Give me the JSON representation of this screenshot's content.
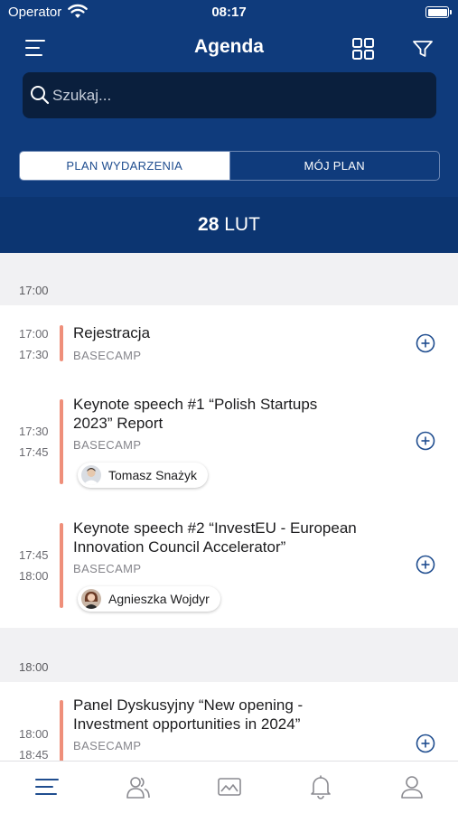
{
  "status_bar": {
    "carrier": "Operator",
    "time": "08:17"
  },
  "header": {
    "title": "Agenda",
    "search_placeholder": "Szukaj...",
    "tabs": [
      {
        "label": "PLAN WYDARZENIA",
        "active": true
      },
      {
        "label": "MÓJ PLAN",
        "active": false
      }
    ],
    "date": {
      "day": "28",
      "month": "LUT"
    }
  },
  "agenda": {
    "groups": [
      {
        "time": "17:00",
        "events": [
          {
            "start": "17:00",
            "end": "17:30",
            "title": "Rejestracja",
            "location": "BASECAMP"
          },
          {
            "start": "17:30",
            "end": "17:45",
            "title_line1": "Keynote speech #1 “Polish Startups",
            "title_line2": "2023” Report",
            "location": "BASECAMP",
            "speaker": "Tomasz Snażyk"
          },
          {
            "start": "17:45",
            "end": "18:00",
            "title_line1": "Keynote speech #2 “InvestEU - European",
            "title_line2": "Innovation Council Accelerator”",
            "location": "BASECAMP",
            "speaker": "Agnieszka Wojdyr"
          }
        ]
      },
      {
        "time": "18:00",
        "events": [
          {
            "start": "18:00",
            "end": "18:45",
            "title_line1": "Panel Dyskusyjny “New opening -",
            "title_line2": "Investment opportunities in 2024”",
            "location": "BASECAMP"
          }
        ]
      }
    ]
  },
  "tabbar": {
    "items": [
      "agenda-icon",
      "people-icon",
      "gallery-icon",
      "notifications-icon",
      "profile-icon"
    ],
    "active": "agenda-icon"
  },
  "colors": {
    "header_bg": "#0f3b7c",
    "accent_bar": "#ef8f7a",
    "brand_blue": "#1f4d8f"
  }
}
